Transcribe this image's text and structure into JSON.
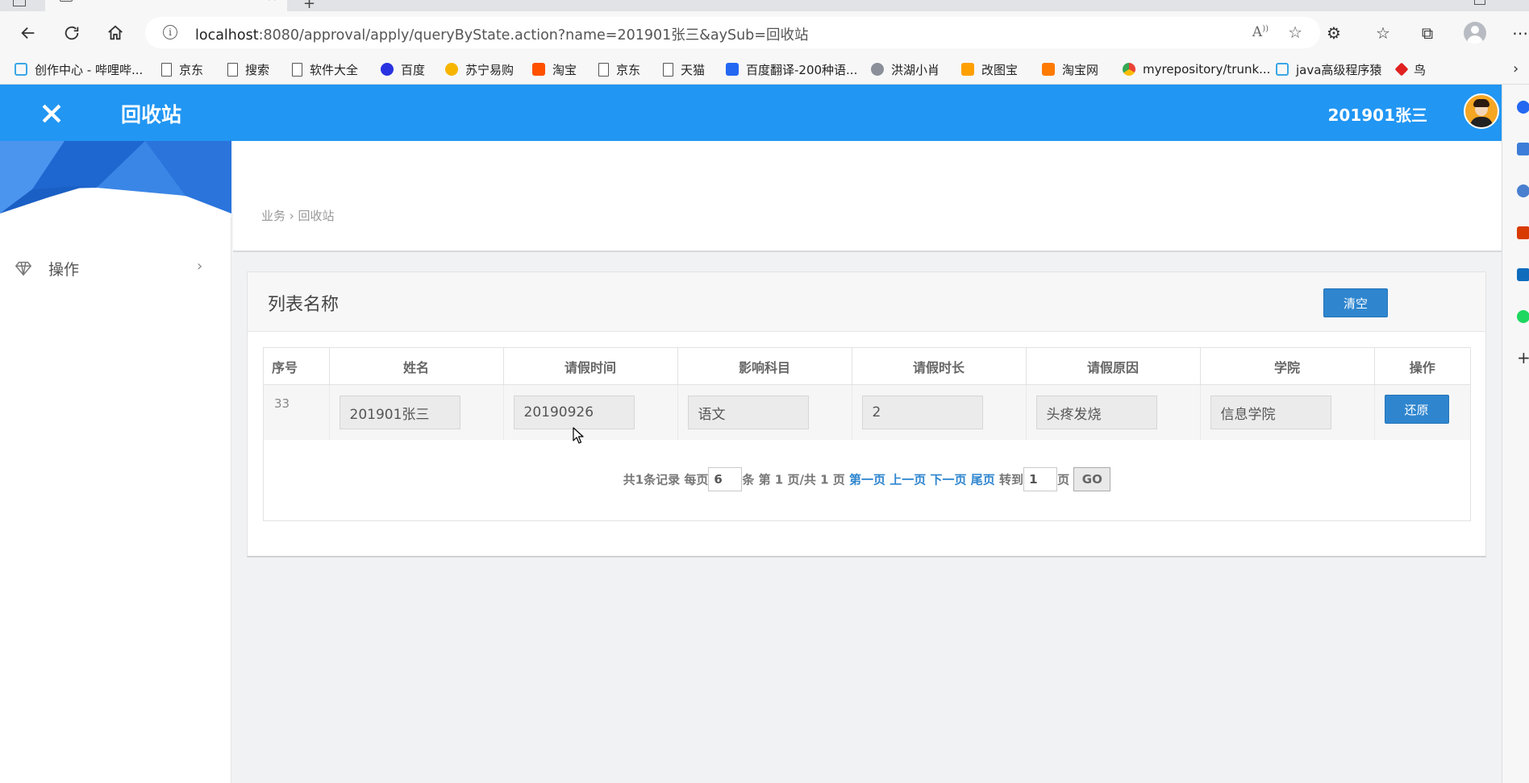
{
  "browser": {
    "url": "localhost:8080/approval/apply/queryByState.action?name=201901张三&aySub=回收站",
    "url_host": "localhost",
    "url_rest": ":8080/approval/apply/queryByState.action?name=201901张三&aySub=回收站",
    "bookmarks": [
      {
        "label": "创作中心 - 哔哩哔...",
        "icon": "bilibili-icon"
      },
      {
        "label": "京东",
        "icon": "page-icon"
      },
      {
        "label": "搜索",
        "icon": "page-icon"
      },
      {
        "label": "软件大全",
        "icon": "page-icon"
      },
      {
        "label": "百度",
        "icon": "baidu-icon"
      },
      {
        "label": "苏宁易购",
        "icon": "suning-icon"
      },
      {
        "label": "淘宝",
        "icon": "taobao-icon"
      },
      {
        "label": "京东",
        "icon": "page-icon"
      },
      {
        "label": "天猫",
        "icon": "page-icon"
      },
      {
        "label": "百度翻译-200种语...",
        "icon": "fanyi-icon"
      },
      {
        "label": "洪湖小肖",
        "icon": "bird-icon"
      },
      {
        "label": "改图宝",
        "icon": "gaitubao-icon"
      },
      {
        "label": "淘宝网",
        "icon": "taobao-icon"
      },
      {
        "label": "myrepository/trunk...",
        "icon": "chrome-icon"
      },
      {
        "label": "java高级程序猿",
        "icon": "bilibili-icon"
      },
      {
        "label": "鸟",
        "icon": "bird-red-icon"
      }
    ]
  },
  "header": {
    "title": "回收站",
    "user": "201901张三",
    "accent": "#2196f3"
  },
  "sidebar": {
    "items": [
      {
        "label": "操作"
      }
    ]
  },
  "breadcrumb": {
    "text": "业务 › 回收站"
  },
  "panel": {
    "title": "列表名称",
    "clear_label": "清空"
  },
  "table": {
    "columns": [
      "序号",
      "姓名",
      "请假时间",
      "影响科目",
      "请假时长",
      "请假原因",
      "学院",
      "操作"
    ],
    "rows": [
      {
        "seq": "33",
        "name": "201901张三",
        "date": "20190926",
        "subject": "语文",
        "duration": "2",
        "reason": "头疼发烧",
        "college": "信息学院",
        "action_label": "还原"
      }
    ]
  },
  "pager": {
    "total_text": "共1条记录 每页",
    "page_size": "6",
    "page_info": "条 第 1 页/共 1 页",
    "first": "第一页",
    "prev": "上一页",
    "next": "下一页",
    "last": "尾页",
    "goto_label": "转到",
    "goto_value": "1",
    "page_suffix": "页",
    "go_label": "GO"
  }
}
